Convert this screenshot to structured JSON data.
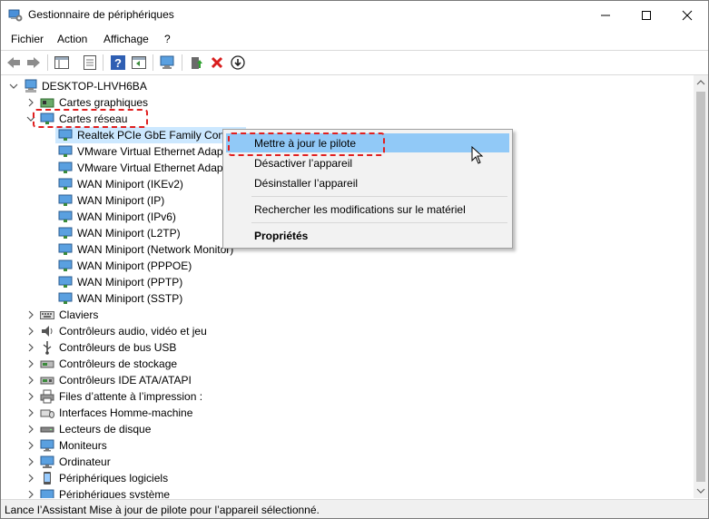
{
  "window": {
    "title": "Gestionnaire de périphériques",
    "controls": [
      "minimize",
      "maximize",
      "close"
    ]
  },
  "menubar": [
    "Fichier",
    "Action",
    "Affichage",
    "?"
  ],
  "toolbar": {
    "icons": [
      "back-icon",
      "forward-icon",
      "show-hide-console-tree-icon",
      "properties-icon",
      "help-icon",
      "action-pane-icon",
      "scan-hardware-icon",
      "update-driver-icon",
      "uninstall-icon",
      "disable-icon"
    ]
  },
  "tree": {
    "root": "DESKTOP-LHVH6BA",
    "items": [
      {
        "label": "Cartes graphiques",
        "expanded": false
      },
      {
        "label": "Cartes réseau",
        "expanded": true,
        "children": [
          "Realtek PCIe GbE Family Contr",
          "VMware Virtual Ethernet Adap",
          "VMware Virtual Ethernet Adap",
          "WAN Miniport (IKEv2)",
          "WAN Miniport (IP)",
          "WAN Miniport (IPv6)",
          "WAN Miniport (L2TP)",
          "WAN Miniport (Network Monitor)",
          "WAN Miniport (PPPOE)",
          "WAN Miniport (PPTP)",
          "WAN Miniport (SSTP)"
        ]
      },
      {
        "label": "Claviers",
        "expanded": false
      },
      {
        "label": "Contrôleurs audio, vidéo et jeu",
        "expanded": false
      },
      {
        "label": "Contrôleurs de bus USB",
        "expanded": false
      },
      {
        "label": "Contrôleurs de stockage",
        "expanded": false
      },
      {
        "label": "Contrôleurs IDE ATA/ATAPI",
        "expanded": false
      },
      {
        "label": "Files d’attente à l’impression :",
        "expanded": false
      },
      {
        "label": "Interfaces Homme-machine",
        "expanded": false
      },
      {
        "label": "Lecteurs de disque",
        "expanded": false
      },
      {
        "label": "Moniteurs",
        "expanded": false
      },
      {
        "label": "Ordinateur",
        "expanded": false
      },
      {
        "label": "Périphériques logiciels",
        "expanded": false
      },
      {
        "label": "Périphériques système",
        "expanded": false
      }
    ]
  },
  "context_menu": {
    "items": [
      {
        "label": "Mettre à jour le pilote",
        "highlighted": true
      },
      {
        "label": "Désactiver l’appareil"
      },
      {
        "label": "Désinstaller l’appareil"
      },
      {
        "label": "Rechercher les modifications sur le matériel"
      },
      {
        "label": "Propriétés",
        "bold": true
      }
    ]
  },
  "status": "Lance l’Assistant Mise à jour de pilote pour l’appareil sélectionné.",
  "colors": {
    "selection": "#cce8ff",
    "annotation": "#e02020",
    "menu_bg": "#f2f2f2"
  }
}
